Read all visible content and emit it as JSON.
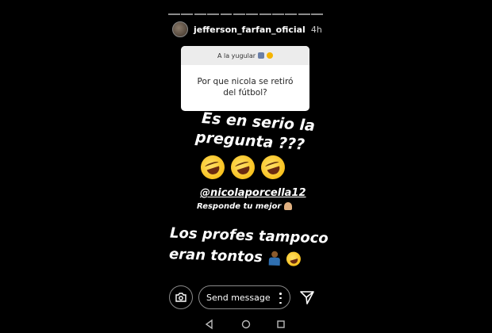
{
  "story": {
    "segments": 12,
    "username": "jefferson_farfan_oficial",
    "time": "4h"
  },
  "question": {
    "header": "A la yugular",
    "line1": "Por que nicola se retiró",
    "line2": "del fútbol?"
  },
  "text": {
    "line1": "Es en serio la",
    "line2": "pregunta ???",
    "mention": "@nicolaporcella12",
    "respond": "Responde tu mejor",
    "line3": "Los profes tampoco",
    "line4": "eran tontos"
  },
  "footer": {
    "message_placeholder": "Send message"
  },
  "icons": {
    "camera": "camera-icon",
    "more": "more-vertical-icon",
    "send": "send-icon",
    "back": "back-triangle-icon",
    "home": "home-circle-icon",
    "recents": "recents-square-icon"
  }
}
